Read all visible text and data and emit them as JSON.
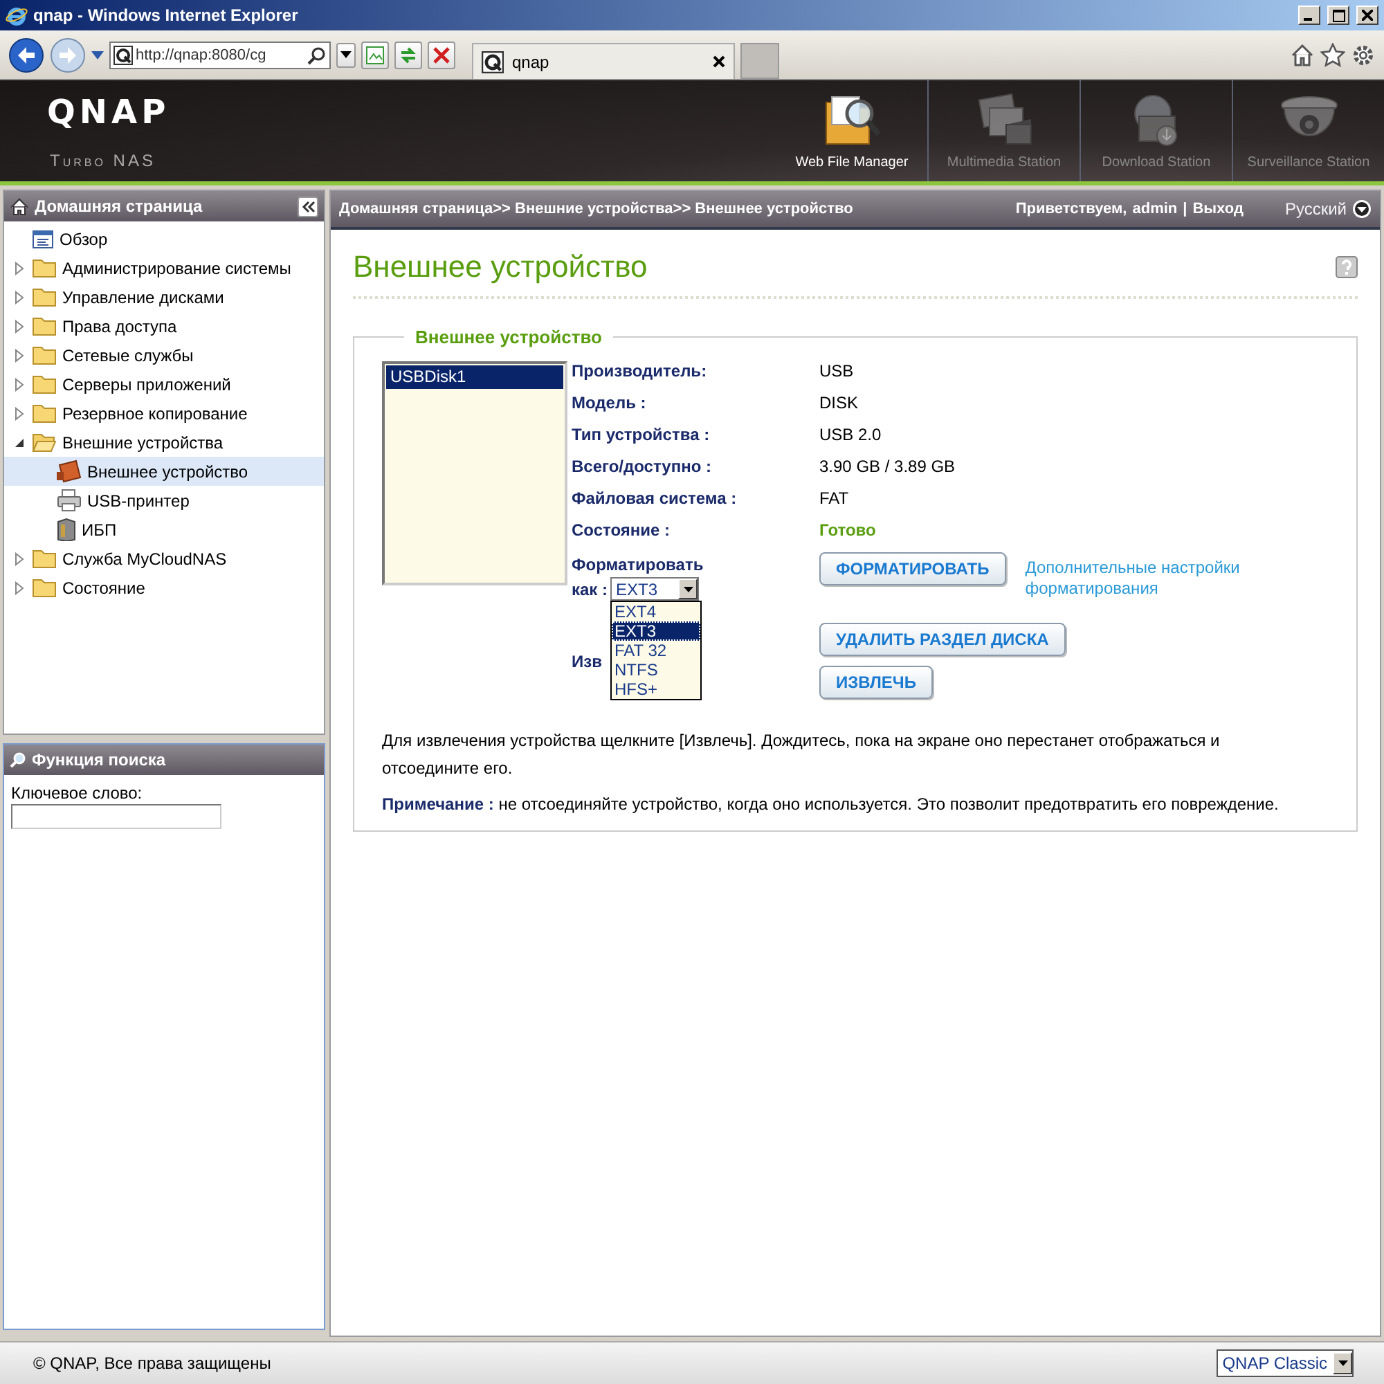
{
  "window": {
    "title": "qnap - Windows Internet Explorer"
  },
  "browser": {
    "address": "http://qnap:8080/cg",
    "tabs": [
      {
        "label": "qnap",
        "selected": true
      }
    ]
  },
  "header": {
    "logo": "QNAP",
    "subtitle": "Turbo NAS",
    "apps": [
      {
        "label": "Web File Manager",
        "kind": "files",
        "selected": true
      },
      {
        "label": "Multimedia Station",
        "kind": "media",
        "selected": false
      },
      {
        "label": "Download Station",
        "kind": "download",
        "selected": false
      },
      {
        "label": "Surveillance Station",
        "kind": "camera",
        "selected": false
      }
    ]
  },
  "sidebar": {
    "title": "Домашняя страница",
    "items": [
      {
        "label": "Обзор",
        "kind": "page",
        "selected": false
      },
      {
        "label": "Администрирование системы",
        "kind": "folder",
        "expanded": false,
        "selected": false
      },
      {
        "label": "Управление дисками",
        "kind": "folder",
        "expanded": false,
        "selected": false
      },
      {
        "label": "Права доступа",
        "kind": "folder",
        "expanded": false,
        "selected": false
      },
      {
        "label": "Сетевые службы",
        "kind": "folder",
        "expanded": false,
        "selected": false
      },
      {
        "label": "Серверы приложений",
        "kind": "folder",
        "expanded": false,
        "selected": false
      },
      {
        "label": "Резервное копирование",
        "kind": "folder",
        "expanded": false,
        "selected": false
      },
      {
        "label": "Внешние устройства",
        "kind": "folder",
        "expanded": true,
        "selected": false,
        "children": [
          {
            "label": "Внешнее устройство",
            "kind": "device",
            "selected": true
          },
          {
            "label": "USB-принтер",
            "kind": "printer",
            "selected": false
          },
          {
            "label": "ИБП",
            "kind": "ups",
            "selected": false
          }
        ]
      },
      {
        "label": "Служба MyCloudNAS",
        "kind": "folder",
        "expanded": false,
        "selected": false
      },
      {
        "label": "Состояние",
        "kind": "folder",
        "expanded": false,
        "selected": false
      }
    ]
  },
  "search": {
    "title": "Функция поиска",
    "label": "Ключевое слово:"
  },
  "topbar": {
    "breadcrumb": "Домашняя страница>> Внешние устройства>> Внешнее устройство",
    "greeting": "Приветствуем,",
    "user": "admin",
    "separator": "|",
    "logout": "Выход",
    "language": "Русский"
  },
  "page": {
    "title": "Внешнее устройство",
    "section": "Внешнее устройство",
    "devices": [
      {
        "label": "USBDisk1",
        "selected": true
      }
    ],
    "fields": [
      {
        "label": "Производитель:",
        "value": "USB",
        "kind": "text"
      },
      {
        "label": "Модель :",
        "value": "DISK",
        "kind": "text"
      },
      {
        "label": "Тип устройства :",
        "value": "USB 2.0",
        "kind": "text"
      },
      {
        "label": "Всего/доступно :",
        "value": "3.90 GB / 3.89 GB",
        "kind": "text"
      },
      {
        "label": "Файловая система :",
        "value": "FAT",
        "kind": "text"
      },
      {
        "label": "Состояние :",
        "value": "Готово",
        "kind": "status"
      }
    ],
    "format": {
      "label": "Форматировать",
      "label_2": "как :",
      "value": "EXT3",
      "expanded": true,
      "options": [
        {
          "label": "EXT4",
          "selected": false
        },
        {
          "label": "EXT3",
          "selected": true
        },
        {
          "label": "FAT 32",
          "selected": false
        },
        {
          "label": "NTFS",
          "selected": false
        },
        {
          "label": "HFS+",
          "selected": false
        }
      ]
    },
    "format_button": "ФОРМАТИРОВАТЬ",
    "advanced_link": "Дополнительные настройки форматирования",
    "eject_label": "Изв",
    "buttons": [
      "УДАЛИТЬ РАЗДЕЛ ДИСКА",
      "ИЗВЛЕЧЬ"
    ],
    "instructions": "Для извлечения устройства щелкните [Извлечь]. Дождитесь, пока на экране оно перестанет отображаться и отсоедините его.",
    "note": "**Примечание :** не отсоединяйте устройство, когда оно используется. Это позволит предотвратить его повреждение."
  },
  "footer": {
    "copyright": "© QNAP, Все права защищены",
    "theme": "QNAP Classic"
  }
}
